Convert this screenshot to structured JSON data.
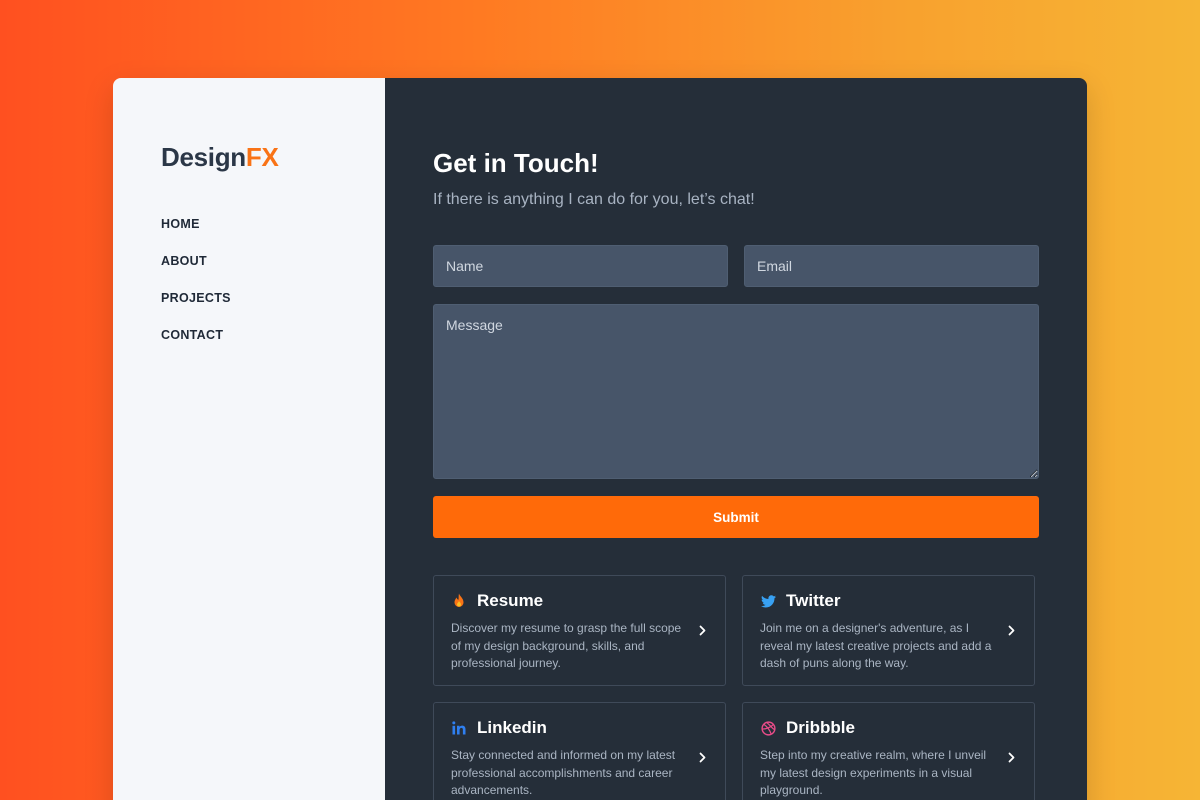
{
  "brand": {
    "name_main": "Design",
    "name_accent": "FX",
    "accent_color": "#f97316"
  },
  "nav": {
    "items": [
      {
        "label": "HOME"
      },
      {
        "label": "ABOUT"
      },
      {
        "label": "PROJECTS"
      },
      {
        "label": "CONTACT"
      }
    ]
  },
  "contact": {
    "title": "Get in Touch!",
    "subtitle": "If there is anything I can do for you, let’s chat!",
    "name_placeholder": "Name",
    "email_placeholder": "Email",
    "message_placeholder": "Message",
    "submit_label": "Submit",
    "submit_color": "#ff6a09"
  },
  "cards": [
    {
      "icon": "fire-icon",
      "title": "Resume",
      "description": "Discover my resume to grasp the full scope of my design background, skills, and professional journey."
    },
    {
      "icon": "twitter-icon",
      "title": "Twitter",
      "description": "Join me on a designer's adventure, as I reveal my latest creative projects and add a dash of puns along the way."
    },
    {
      "icon": "linkedin-icon",
      "title": "Linkedin",
      "description": "Stay connected and informed on my latest professional accomplishments and career advancements."
    },
    {
      "icon": "dribbble-icon",
      "title": "Dribbble",
      "description": "Step into my creative realm, where I unveil my latest design experiments in a visual playground."
    }
  ]
}
